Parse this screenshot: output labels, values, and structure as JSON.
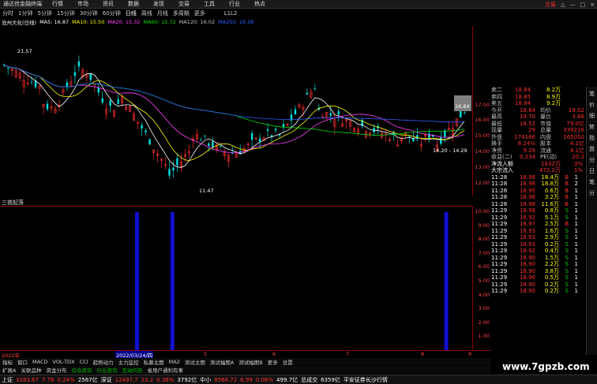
{
  "menubar": {
    "app_name": "通达信金融终端",
    "items": [
      "行情",
      "市场",
      "资讯",
      "数据",
      "发现",
      "交易",
      "工具",
      "行业",
      "热点"
    ],
    "right": [
      "交易",
      "△",
      "—",
      "□",
      "×"
    ]
  },
  "toolbar": {
    "items": [
      "分时",
      "1分钟",
      "5分钟",
      "15分钟",
      "30分钟",
      "60分钟",
      "日线",
      "周线",
      "月线",
      "多周期",
      "更多"
    ],
    "active": "日线",
    "extra": "L1L2"
  },
  "ma_legend": {
    "stock": "沧州大化(日线)",
    "items": [
      {
        "label": "MA5: 16.87",
        "color": "#ffffff"
      },
      {
        "label": "MA10: 15.50",
        "color": "#ffff00"
      },
      {
        "label": "MA20: 15.32",
        "color": "#ff40ff"
      },
      {
        "label": "MA60: 15.72",
        "color": "#00e000"
      },
      {
        "label": "MA120: 16.02",
        "color": "#c0c0c0"
      },
      {
        "label": "MA250: 16.38",
        "color": "#3060ff"
      }
    ]
  },
  "main_chart": {
    "price_high_label": "21.57",
    "price_low_label": "11.47",
    "last_label": "16.84",
    "low_range_label": "14.20 - 14.29",
    "y_ticks": [
      17.0,
      16.0,
      15.0,
      14.0,
      13.0,
      12.0
    ],
    "ylim": [
      11.2,
      22.0
    ]
  },
  "chart_data": {
    "type": "bar",
    "title": "三夜起落",
    "y_ticks": [
      10.0,
      9.0,
      8.0,
      7.0,
      6.0,
      5.0,
      4.0,
      3.0,
      2.0,
      1.0
    ],
    "ylim": [
      0,
      10.4
    ],
    "bars": [
      {
        "position": 0.29,
        "value": 10.0
      },
      {
        "position": 0.365,
        "value": 10.0
      },
      {
        "position": 0.945,
        "value": 10.0
      }
    ]
  },
  "date_axis": {
    "labels": [
      "2022年",
      "2022/03/24/四",
      "5",
      "6",
      "7",
      "8",
      "9"
    ]
  },
  "tabs1": [
    "指标",
    "窗口",
    "MACD",
    "VOL-TDX",
    "CCI",
    "趋势动力",
    "主力监控",
    "私募主图",
    "MA2",
    "测试主图",
    "测试幅图A",
    "测试幅图B",
    "更多",
    "设置"
  ],
  "tabs2": [
    "扩展A",
    "关联品种",
    "资金分布",
    "综合资讯",
    "行业资讯",
    "互动问答",
    "省用户通利有事"
  ],
  "side_tabs": [
    "笔",
    "价",
    "细",
    "势",
    "指",
    "盘",
    "分",
    "日",
    "笔",
    "分"
  ],
  "right_panel": {
    "orders": [
      {
        "label": "卖二",
        "price": "18.84",
        "vol": "8.2万"
      },
      {
        "label": "卖四",
        "price": "18.85",
        "vol": "8.9万"
      },
      {
        "label": "卖五",
        "price": "18.84",
        "vol": "9.2万"
      }
    ],
    "stats": [
      {
        "k1": "今开",
        "v1": "18.84",
        "k2": "均价",
        "v2": "19.02"
      },
      {
        "k1": "最高",
        "v1": "19.70",
        "k2": "量比",
        "v2": "3.66"
      },
      {
        "k1": "最低",
        "v1": "18.52",
        "k2": "市值",
        "v2": "79.0亿"
      },
      {
        "k1": "现量",
        "v1": "29",
        "k2": "总量",
        "v2": "339216"
      },
      {
        "k1": "外盘",
        "v1": "174166",
        "k2": "内盘",
        "v2": "165050"
      },
      {
        "k1": "换手",
        "v1": "8.24%",
        "k2": "股本",
        "v2": "4.1亿"
      },
      {
        "k1": "净资",
        "v1": "9.29",
        "k2": "流通",
        "v2": "4.1亿"
      },
      {
        "k1": "收益(二)",
        "v1": "0.234",
        "k2": "PE(动)",
        "v2": "20.2"
      }
    ],
    "flows": [
      {
        "k": "净流入额",
        "v": "1832万",
        "p": "3%"
      },
      {
        "k": "大宗流入",
        "v": "472.2万",
        "p": "1%"
      }
    ],
    "ticks": [
      {
        "t": "11:28",
        "p": "18.98",
        "v": "18.4万",
        "d": "B",
        "n": "1"
      },
      {
        "t": "11:28",
        "p": "18.98",
        "v": "18.8万",
        "d": "B",
        "n": "2"
      },
      {
        "t": "11:28",
        "p": "18.95",
        "v": "0.6万",
        "d": "B",
        "n": "1"
      },
      {
        "t": "11:28",
        "p": "18.98",
        "v": "3.2万",
        "d": "B",
        "n": "1"
      },
      {
        "t": "11:28",
        "p": "18.98",
        "v": "11.6万",
        "d": "B",
        "n": "1"
      },
      {
        "t": "11:29",
        "p": "18.98",
        "v": "0.8万",
        "d": "S",
        "n": "1"
      },
      {
        "t": "11:29",
        "p": "18.92",
        "v": "5.1万",
        "d": "S",
        "n": "1"
      },
      {
        "t": "11:29",
        "p": "18.97",
        "v": "2.5万",
        "d": "B",
        "n": "1"
      },
      {
        "t": "11:29",
        "p": "18.93",
        "v": "1.6万",
        "d": "S",
        "n": "1"
      },
      {
        "t": "11:29",
        "p": "18.93",
        "v": "2.9万",
        "d": "S",
        "n": "1"
      },
      {
        "t": "11:29",
        "p": "18.93",
        "v": "0.2万",
        "d": "S",
        "n": "1"
      },
      {
        "t": "11:29",
        "p": "18.92",
        "v": "0.4万",
        "d": "S",
        "n": "1"
      },
      {
        "t": "11:29",
        "p": "18.90",
        "v": "1.5万",
        "d": "S",
        "n": "1"
      },
      {
        "t": "11:29",
        "p": "18.90",
        "v": "2.2万",
        "d": "S",
        "n": "1"
      },
      {
        "t": "11:29",
        "p": "18.90",
        "v": "3.8万",
        "d": "S",
        "n": "1"
      },
      {
        "t": "11:29",
        "p": "18.90",
        "v": "0.5万",
        "d": "S",
        "n": "1"
      },
      {
        "t": "11:29",
        "p": "18.90",
        "v": "0.2万",
        "d": "S",
        "n": "1"
      },
      {
        "t": "11:29",
        "p": "18.90",
        "v": "0.2万",
        "d": "S",
        "n": "1"
      }
    ]
  },
  "tickerbar": {
    "items": [
      {
        "name": "上证",
        "value": "3283.87",
        "change": "7.78",
        "pct": "0.24%",
        "amount": "2567亿"
      },
      {
        "name": "深证",
        "value": "12497.7",
        "change": "23.2",
        "pct": "0.38%",
        "amount": "3792亿"
      },
      {
        "name": "中小",
        "value": "8566.72",
        "change": "6.99",
        "pct": "0.08%",
        "amount": "499.7亿"
      },
      {
        "name": "总成交",
        "value": "",
        "change": "",
        "pct": "",
        "amount": "6359亿"
      }
    ],
    "news": "平安证券长沙行情",
    "watermark": "www.7gpzb.com"
  }
}
